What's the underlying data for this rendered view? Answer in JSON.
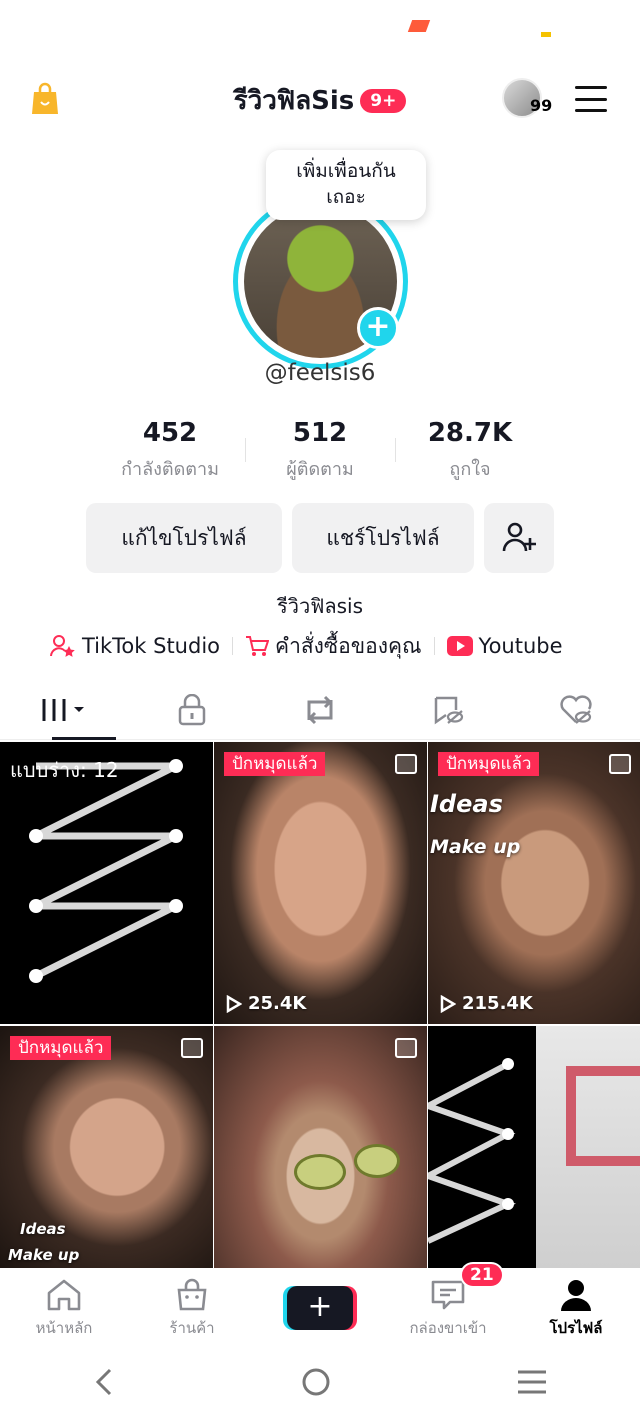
{
  "top": {
    "title": "รีวิวฟิลSis",
    "notif_badge": "9+",
    "avatar_count": "99"
  },
  "profile": {
    "bubble": "เพิ่มเพื่อนกัน เถอะ",
    "handle": "@feelsis6",
    "stats": [
      {
        "value": "452",
        "label": "กำลังติดตาม"
      },
      {
        "value": "512",
        "label": "ผู้ติดตาม"
      },
      {
        "value": "28.7K",
        "label": "ถูกใจ"
      }
    ],
    "edit_label": "แก้ไขโปรไฟล์",
    "share_label": "แชร์โปรไฟล์",
    "bio": "รีวิวฟิลsis",
    "links": {
      "studio": "TikTok Studio",
      "orders": "คำสั่งซื้อของคุณ",
      "youtube": "Youtube"
    }
  },
  "grid": {
    "drafts_label": "แบบร่าง: 12",
    "pinned_label": "ปักหมุดแล้ว",
    "videos": [
      {
        "views": "25.4K"
      },
      {
        "views": "215.4K",
        "overlay_top": "Ideas",
        "overlay_bottom": "Make up"
      }
    ],
    "row2_overlay_top": "Ideas",
    "row2_overlay_bottom": "Make up"
  },
  "nav": {
    "home": "หน้าหลัก",
    "shop": "ร้านค้า",
    "inbox": "กล่องขาเข้า",
    "inbox_badge": "21",
    "profile": "โปรไฟล์"
  },
  "colors": {
    "accent_pink": "#fe2c55",
    "accent_cyan": "#20d5ec"
  }
}
